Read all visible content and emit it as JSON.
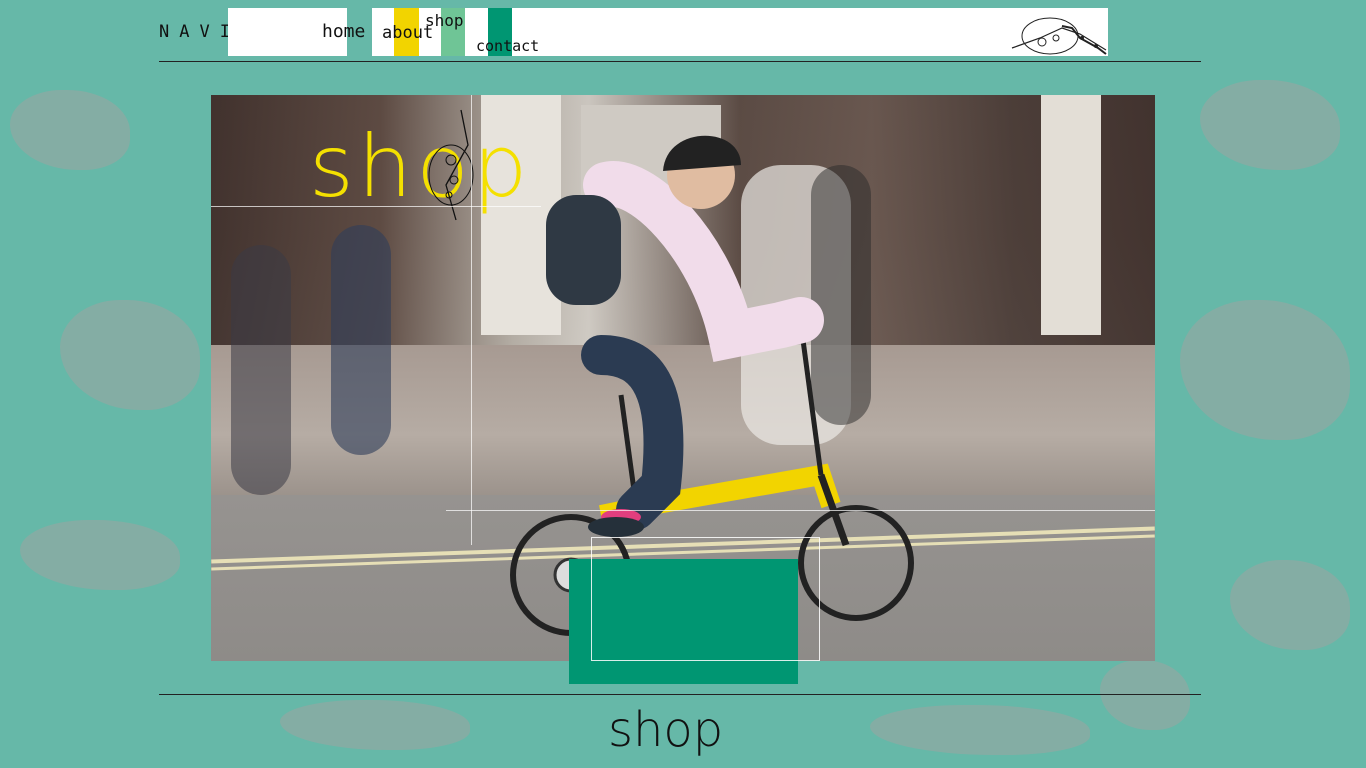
{
  "nav": {
    "label": "NAVIGATE",
    "links": [
      {
        "label": "home"
      },
      {
        "label": "about"
      },
      {
        "label": "shop"
      },
      {
        "label": "contact"
      }
    ]
  },
  "hero": {
    "title": "shop",
    "alt": "bike-icon"
  },
  "footer": {
    "title": "shop"
  },
  "colors": {
    "background": "#66b8a8",
    "accent_yellow": "#f2d400",
    "accent_green": "#009672",
    "accent_mint": "#6fc596"
  }
}
